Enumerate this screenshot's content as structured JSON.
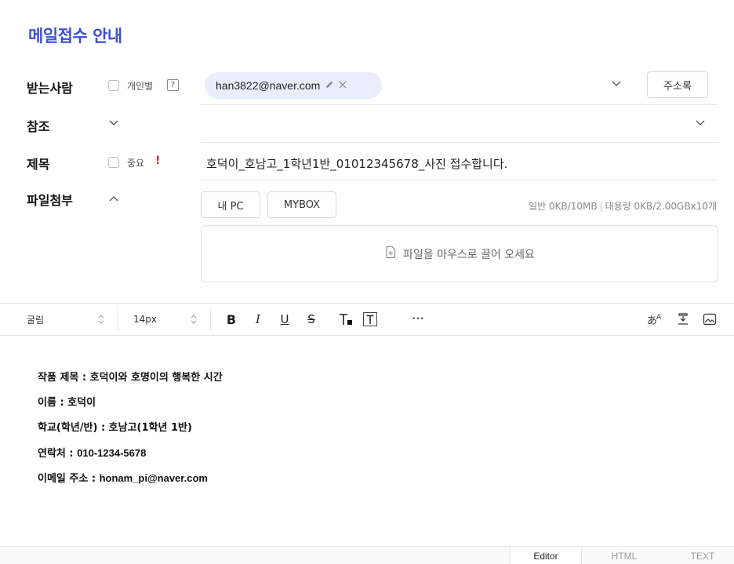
{
  "page": {
    "title": "메일접수 안내"
  },
  "recipient": {
    "label": "받는사람",
    "individual_label": "개인별",
    "help": "?",
    "chip_address": "han3822@naver.com",
    "address_book": "주소록"
  },
  "cc": {
    "label": "참조"
  },
  "subject": {
    "label": "제목",
    "important_label": "중요",
    "important_mark": "!",
    "value": "호덕이_호남고_1학년1반_01012345678_사진 접수합니다."
  },
  "attach": {
    "label": "파일첨부",
    "my_pc": "내 PC",
    "mybox": "MYBOX",
    "quota_normal": "일반 0KB/10MB",
    "quota_sep": "|",
    "quota_large": "대용량 0KB/2.00GBx10개",
    "drop_text": "파일을 마우스로 끌어 오세요"
  },
  "toolbar": {
    "font": "굴림",
    "size": "14px",
    "bold": "B",
    "italic": "I",
    "underline": "U",
    "strike": "S",
    "more": "•••"
  },
  "body": {
    "line1": "작품 제목 : 호덕이와 호명이의 행복한 시간",
    "line2": "이름 : 호덕이",
    "line3": "학교(학년/반) : 호남고(1학년 1반)",
    "line4_label": "연락처 : ",
    "line4_value": "010-1234-5678",
    "line5_label": "이메일 주소 : ",
    "line5_value": "honam_pi@naver.com"
  },
  "footer": {
    "tabs": [
      "Editor",
      "HTML",
      "TEXT"
    ],
    "active": "Editor"
  },
  "colors": {
    "accent": "#3b4fd8",
    "chip_bg": "#e8eefc",
    "important": "#e02020"
  }
}
